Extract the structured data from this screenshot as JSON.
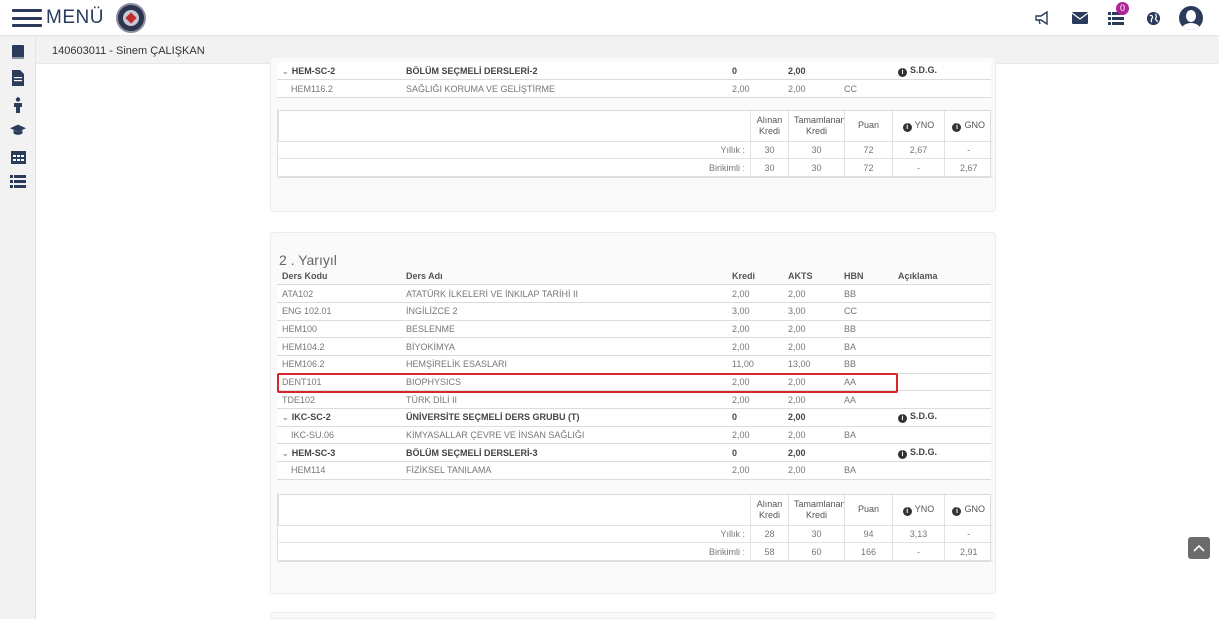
{
  "topbar": {
    "menu_label": "MENÜ",
    "notifications_badge": "0",
    "icons": [
      "bullhorn-icon",
      "envelope-icon",
      "list-icon",
      "globe-icon",
      "user-icon"
    ]
  },
  "user": {
    "label": "140603011 - Sinem ÇALIŞKAN"
  },
  "sidebar": {
    "icons": [
      "book-icon",
      "document-icon",
      "person-icon",
      "graduation-cap-icon",
      "calendar-icon",
      "list-icon"
    ]
  },
  "semester1": {
    "rows": [
      {
        "kod": "HEM-SC-2",
        "ad": "BÖLÜM SEÇMELİ DERSLERİ-2",
        "kredi": "0",
        "akts": "2,00",
        "hbn": "",
        "aciklama": "S.D.G."
      },
      {
        "kod": "HEM116.2",
        "ad": "SAĞLIĞI KORUMA VE GELİŞTİRME",
        "kredi": "2,00",
        "akts": "2,00",
        "hbn": "CC",
        "aciklama": ""
      }
    ],
    "summary": {
      "headers": [
        "Alınan Kredi",
        "Tamamlanan Kredi",
        "Puan",
        "YNO",
        "GNO"
      ],
      "yillik": {
        "label": "Yıllık :",
        "values": [
          "30",
          "30",
          "72",
          "2,67",
          "-"
        ]
      },
      "birikimli": {
        "label": "Birikimli :",
        "values": [
          "30",
          "30",
          "72",
          "-",
          "2,67"
        ]
      }
    }
  },
  "semester2": {
    "title": "2 . Yarıyıl",
    "headers": {
      "kod": "Ders Kodu",
      "ad": "Ders Adı",
      "kredi": "Kredi",
      "akts": "AKTS",
      "hbn": "HBN",
      "aciklama": "Açıklama"
    },
    "rows": [
      {
        "kod": "ATA102",
        "ad": "ATATÜRK İLKELERİ VE İNKILAP TARİHİ II",
        "kredi": "2,00",
        "akts": "2,00",
        "hbn": "BB",
        "aciklama": ""
      },
      {
        "kod": "ENG 102.01",
        "ad": "İNGİLİZCE 2",
        "kredi": "3,00",
        "akts": "3,00",
        "hbn": "CC",
        "aciklama": ""
      },
      {
        "kod": "HEM100",
        "ad": "BESLENME",
        "kredi": "2,00",
        "akts": "2,00",
        "hbn": "BB",
        "aciklama": ""
      },
      {
        "kod": "HEM104.2",
        "ad": "BİYOKİMYA",
        "kredi": "2,00",
        "akts": "2,00",
        "hbn": "BA",
        "aciklama": ""
      },
      {
        "kod": "HEM106.2",
        "ad": "HEMŞİRELİK ESASLARI",
        "kredi": "11,00",
        "akts": "13,00",
        "hbn": "BB",
        "aciklama": ""
      },
      {
        "kod": "DENT101",
        "ad": "BIOPHYSICS",
        "kredi": "2,00",
        "akts": "2,00",
        "hbn": "AA",
        "aciklama": ""
      },
      {
        "kod": "TDE102",
        "ad": "TÜRK DİLİ II",
        "kredi": "2,00",
        "akts": "2,00",
        "hbn": "AA",
        "aciklama": ""
      },
      {
        "kod": "IKC-SC-2",
        "ad": "ÜNİVERSİTE SEÇMELİ DERS GRUBU (T)",
        "kredi": "0",
        "akts": "2,00",
        "hbn": "",
        "aciklama": "S.D.G."
      },
      {
        "kod": "IKC-SU.06",
        "ad": "KİMYASALLAR ÇEVRE VE İNSAN SAĞLIĞI",
        "kredi": "2,00",
        "akts": "2,00",
        "hbn": "BA",
        "aciklama": ""
      },
      {
        "kod": "HEM-SC-3",
        "ad": "BÖLÜM SEÇMELİ DERSLERİ-3",
        "kredi": "0",
        "akts": "2,00",
        "hbn": "",
        "aciklama": "S.D.G."
      },
      {
        "kod": "HEM114",
        "ad": "FİZİKSEL TANILAMA",
        "kredi": "2,00",
        "akts": "2,00",
        "hbn": "BA",
        "aciklama": ""
      }
    ],
    "summary": {
      "headers": [
        "Alınan Kredi",
        "Tamamlanan Kredi",
        "Puan",
        "YNO",
        "GNO"
      ],
      "yillik": {
        "label": "Yıllık :",
        "values": [
          "28",
          "30",
          "94",
          "3,13",
          "-"
        ]
      },
      "birikimli": {
        "label": "Birikimli :",
        "values": [
          "58",
          "60",
          "166",
          "-",
          "2,91"
        ]
      }
    }
  },
  "colors": {
    "navy": "#2a3b5c",
    "highlight": "#d9232d",
    "badge": "#b0259a"
  }
}
